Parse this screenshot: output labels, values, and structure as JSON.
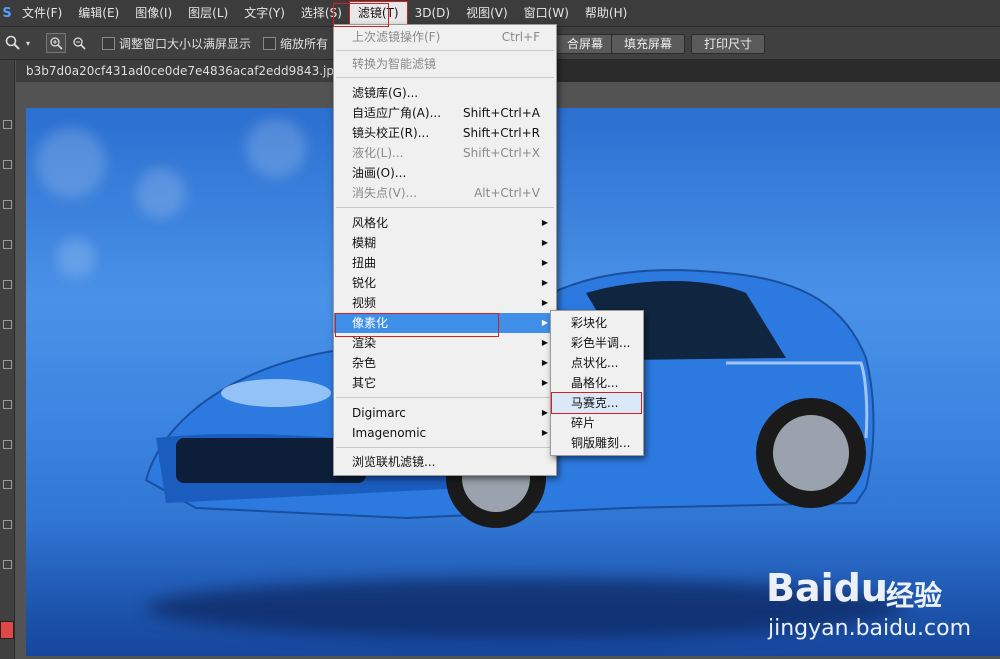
{
  "menubar": {
    "logo": "S",
    "items": [
      "文件(F)",
      "编辑(E)",
      "图像(I)",
      "图层(L)",
      "文字(Y)",
      "选择(S)",
      "滤镜(T)",
      "3D(D)",
      "视图(V)",
      "窗口(W)",
      "帮助(H)"
    ]
  },
  "options": {
    "resize_windows": "调整窗口大小以满屏显示",
    "zoom_all": "缩放所有",
    "fill_screen_left": "合屏幕",
    "fill_screen": "填充屏幕",
    "print_size": "打印尺寸"
  },
  "document": {
    "tab_title": "b3b7d0a20cf431ad0ce0de7e4836acaf2edd9843.jpg @ 28."
  },
  "filter_menu": {
    "last_filter": {
      "label": "上次滤镜操作(F)",
      "shortcut": "Ctrl+F"
    },
    "convert_smart": "转换为智能滤镜",
    "filter_gallery": "滤镜库(G)...",
    "adaptive_wide": {
      "label": "自适应广角(A)...",
      "shortcut": "Shift+Ctrl+A"
    },
    "lens_correction": {
      "label": "镜头校正(R)...",
      "shortcut": "Shift+Ctrl+R"
    },
    "liquify": {
      "label": "液化(L)...",
      "shortcut": "Shift+Ctrl+X"
    },
    "oil_paint": "油画(O)...",
    "vanishing_point": {
      "label": "消失点(V)...",
      "shortcut": "Alt+Ctrl+V"
    },
    "stylize": "风格化",
    "blur": "模糊",
    "distort": "扭曲",
    "sharpen": "锐化",
    "video": "视频",
    "pixelate": "像素化",
    "render": "渲染",
    "noise": "杂色",
    "other": "其它",
    "digimarc": "Digimarc",
    "imagenomic": "Imagenomic",
    "browse_online": "浏览联机滤镜..."
  },
  "pixelate_submenu": [
    "彩块化",
    "彩色半调...",
    "点状化...",
    "晶格化...",
    "马赛克...",
    "碎片",
    "铜版雕刻..."
  ],
  "watermark": {
    "brand": "Bai",
    "brand2": "du",
    "suffix": "经验",
    "url": "jingyan.baidu.com"
  },
  "colors": {
    "highlight": "#3f8fe8",
    "annotation_red": "#d42020",
    "foreground_swatch": "#e04848"
  }
}
